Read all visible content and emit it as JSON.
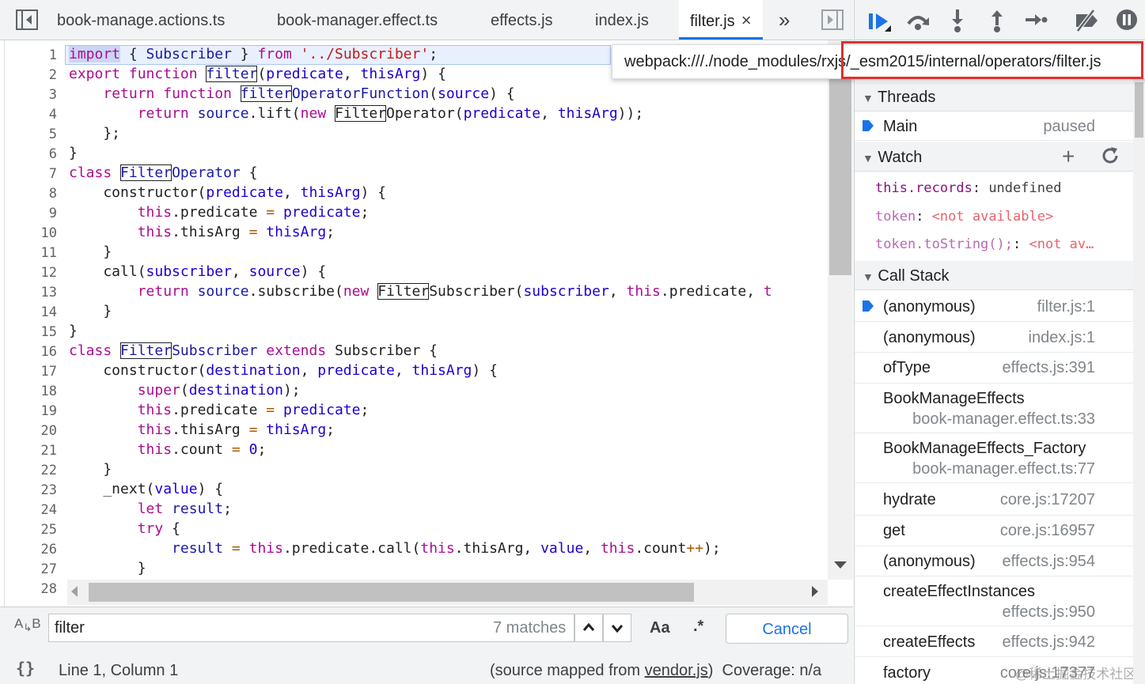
{
  "tabs": [
    {
      "label": "book-manage.actions.ts",
      "active": false
    },
    {
      "label": "book-manager.effect.ts",
      "active": false
    },
    {
      "label": "effects.js",
      "active": false
    },
    {
      "label": "index.js",
      "active": false
    },
    {
      "label": "filter.js",
      "active": true
    }
  ],
  "tab_close": "×",
  "tab_overflow": "»",
  "tooltip": "webpack:///./node_modules/rxjs/_esm2015/internal/operators/filter.js",
  "line_numbers": [
    "1",
    "2",
    "3",
    "4",
    "5",
    "6",
    "7",
    "8",
    "9",
    "10",
    "11",
    "12",
    "13",
    "14",
    "15",
    "16",
    "17",
    "18",
    "19",
    "20",
    "21",
    "22",
    "23",
    "24",
    "25",
    "26",
    "27",
    "28"
  ],
  "search": {
    "value": "filter",
    "matches": "7 matches",
    "case_label": "Aa",
    "regex_label": ".*",
    "cancel_label": "Cancel"
  },
  "status": {
    "position": "Line 1, Column 1",
    "source_prefix": "(source mapped from ",
    "source_file": "vendor.js",
    "source_suffix": ")",
    "coverage": "Coverage: n/a"
  },
  "threads": {
    "title": "Threads",
    "items": [
      {
        "name": "Main",
        "state": "paused"
      }
    ]
  },
  "watch": {
    "title": "Watch",
    "items": [
      {
        "expr": "this.records",
        "value": "undefined",
        "available": true
      },
      {
        "expr": "token",
        "value": "<not available>",
        "available": false
      },
      {
        "expr": "token.toString();",
        "value": "<not av…",
        "available": false
      }
    ]
  },
  "call_stack": {
    "title": "Call Stack",
    "frames": [
      {
        "name": "(anonymous)",
        "loc": "filter.js:1",
        "current": true
      },
      {
        "name": "(anonymous)",
        "loc": "index.js:1",
        "current": false
      },
      {
        "name": "ofType",
        "loc": "effects.js:391",
        "current": false
      },
      {
        "name": "BookManageEffects",
        "loc": "book-manager.effect.ts:33",
        "current": false
      },
      {
        "name": "BookManageEffects_Factory",
        "loc": "book-manager.effect.ts:77",
        "current": false
      },
      {
        "name": "hydrate",
        "loc": "core.js:17207",
        "current": false
      },
      {
        "name": "get",
        "loc": "core.js:16957",
        "current": false
      },
      {
        "name": "(anonymous)",
        "loc": "effects.js:954",
        "current": false
      },
      {
        "name": "createEffectInstances",
        "loc": "effects.js:950",
        "current": false
      },
      {
        "name": "createEffects",
        "loc": "effects.js:942",
        "current": false
      },
      {
        "name": "factory",
        "loc": "core.js:17377",
        "current": false
      }
    ]
  },
  "watermark": "@稀土掘金技术社区",
  "colors": {
    "accent": "#1a73e8",
    "highlight_border": "#e03030",
    "keyword": "#aa0d91"
  }
}
